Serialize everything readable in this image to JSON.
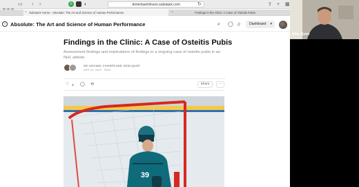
{
  "browser": {
    "url": "drmichaelchivers.substack.com",
    "tabs": [
      {
        "label": "Substack Home - Absolute: The Art and Science of Human Performance"
      },
      {
        "label": "Findings in the Clinic: A Case of Osteitis Pubis"
      }
    ]
  },
  "header": {
    "site_title": "Absolute: The Art and Science of Human Performance",
    "dashboard_label": "Dashboard"
  },
  "article": {
    "title": "Findings in the Clinic: A Case of Osteitis Pubis",
    "subtitle": "Assessment findings and implications of findings in a ongoing case of osteitis pubis in an NHL athlete.",
    "authors": "DR. MICHAEL CHIVERS AND JOHN QUINT",
    "date": "APR 30, 2024 · PAID",
    "like_count": "3",
    "share_label": "Share",
    "more_label": "···"
  },
  "hero": {
    "jersey_number": "39"
  },
  "video": {
    "participant_name": "John Quint"
  }
}
